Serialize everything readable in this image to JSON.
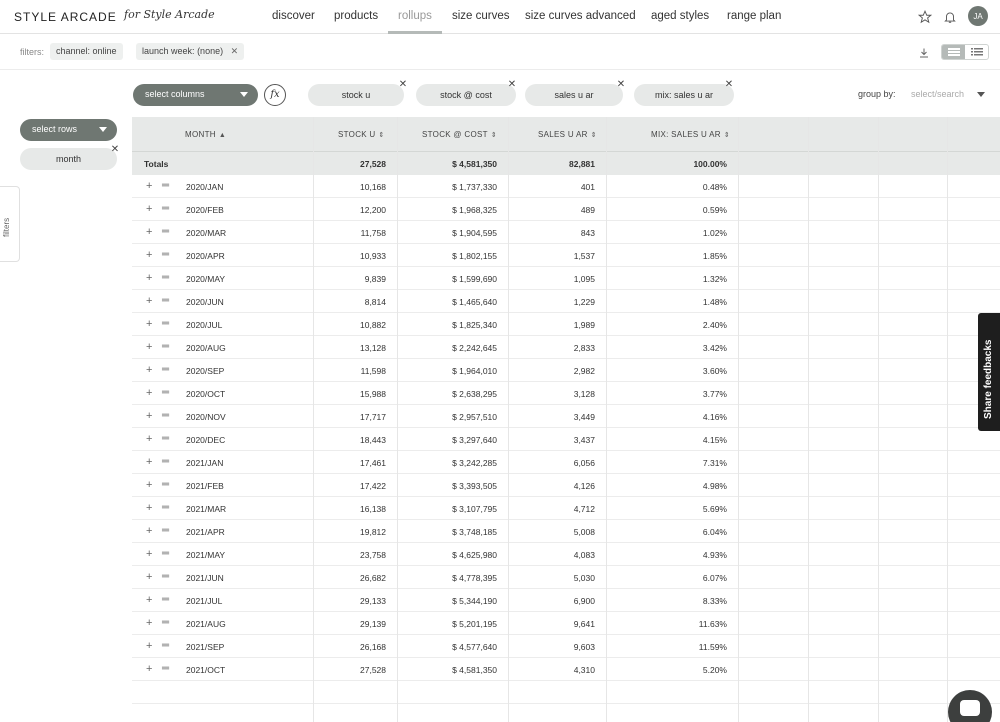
{
  "header": {
    "logo": "STYLE ARCADE",
    "logo_script": "for Style Arcade",
    "nav": [
      "discover",
      "products",
      "rollups",
      "size curves",
      "size curves advanced",
      "aged styles",
      "range plan"
    ],
    "active_nav": "rollups",
    "avatar_initials": "JA"
  },
  "filters": {
    "label": "filters:",
    "chips": [
      {
        "key": "channel:",
        "value": "online",
        "closable": false
      },
      {
        "key": "launch week:",
        "value": "(none)",
        "closable": true
      }
    ]
  },
  "sidebar": {
    "filters_tab": "filters",
    "select_rows": "select rows",
    "row_pill": "month"
  },
  "toolbar": {
    "select_columns": "select columns",
    "fx": "fx",
    "column_pills": [
      "stock u",
      "stock @ cost",
      "sales u ar",
      "mix: sales u ar"
    ],
    "group_by_label": "group by:",
    "group_by_placeholder": "select/search"
  },
  "table": {
    "headers": [
      "MONTH",
      "STOCK U",
      "STOCK @ COST",
      "SALES U AR",
      "MIX: SALES U AR"
    ],
    "totals": {
      "label": "Totals",
      "stock_u": "27,528",
      "stock_cost": "$ 4,581,350",
      "sales_u": "82,881",
      "mix": "100.00%"
    },
    "rows": [
      [
        "2020/JAN",
        "10,168",
        "$ 1,737,330",
        "401",
        "0.48%"
      ],
      [
        "2020/FEB",
        "12,200",
        "$ 1,968,325",
        "489",
        "0.59%"
      ],
      [
        "2020/MAR",
        "11,758",
        "$ 1,904,595",
        "843",
        "1.02%"
      ],
      [
        "2020/APR",
        "10,933",
        "$ 1,802,155",
        "1,537",
        "1.85%"
      ],
      [
        "2020/MAY",
        "9,839",
        "$ 1,599,690",
        "1,095",
        "1.32%"
      ],
      [
        "2020/JUN",
        "8,814",
        "$ 1,465,640",
        "1,229",
        "1.48%"
      ],
      [
        "2020/JUL",
        "10,882",
        "$ 1,825,340",
        "1,989",
        "2.40%"
      ],
      [
        "2020/AUG",
        "13,128",
        "$ 2,242,645",
        "2,833",
        "3.42%"
      ],
      [
        "2020/SEP",
        "11,598",
        "$ 1,964,010",
        "2,982",
        "3.60%"
      ],
      [
        "2020/OCT",
        "15,988",
        "$ 2,638,295",
        "3,128",
        "3.77%"
      ],
      [
        "2020/NOV",
        "17,717",
        "$ 2,957,510",
        "3,449",
        "4.16%"
      ],
      [
        "2020/DEC",
        "18,443",
        "$ 3,297,640",
        "3,437",
        "4.15%"
      ],
      [
        "2021/JAN",
        "17,461",
        "$ 3,242,285",
        "6,056",
        "7.31%"
      ],
      [
        "2021/FEB",
        "17,422",
        "$ 3,393,505",
        "4,126",
        "4.98%"
      ],
      [
        "2021/MAR",
        "16,138",
        "$ 3,107,795",
        "4,712",
        "5.69%"
      ],
      [
        "2021/APR",
        "19,812",
        "$ 3,748,185",
        "5,008",
        "6.04%"
      ],
      [
        "2021/MAY",
        "23,758",
        "$ 4,625,980",
        "4,083",
        "4.93%"
      ],
      [
        "2021/JUN",
        "26,682",
        "$ 4,778,395",
        "5,030",
        "6.07%"
      ],
      [
        "2021/JUL",
        "29,133",
        "$ 5,344,190",
        "6,900",
        "8.33%"
      ],
      [
        "2021/AUG",
        "29,139",
        "$ 5,201,195",
        "9,641",
        "11.63%"
      ],
      [
        "2021/SEP",
        "26,168",
        "$ 4,577,640",
        "9,603",
        "11.59%"
      ],
      [
        "2021/OCT",
        "27,528",
        "$ 4,581,350",
        "4,310",
        "5.20%"
      ]
    ]
  },
  "feedback_tab": "Share feedbacks"
}
